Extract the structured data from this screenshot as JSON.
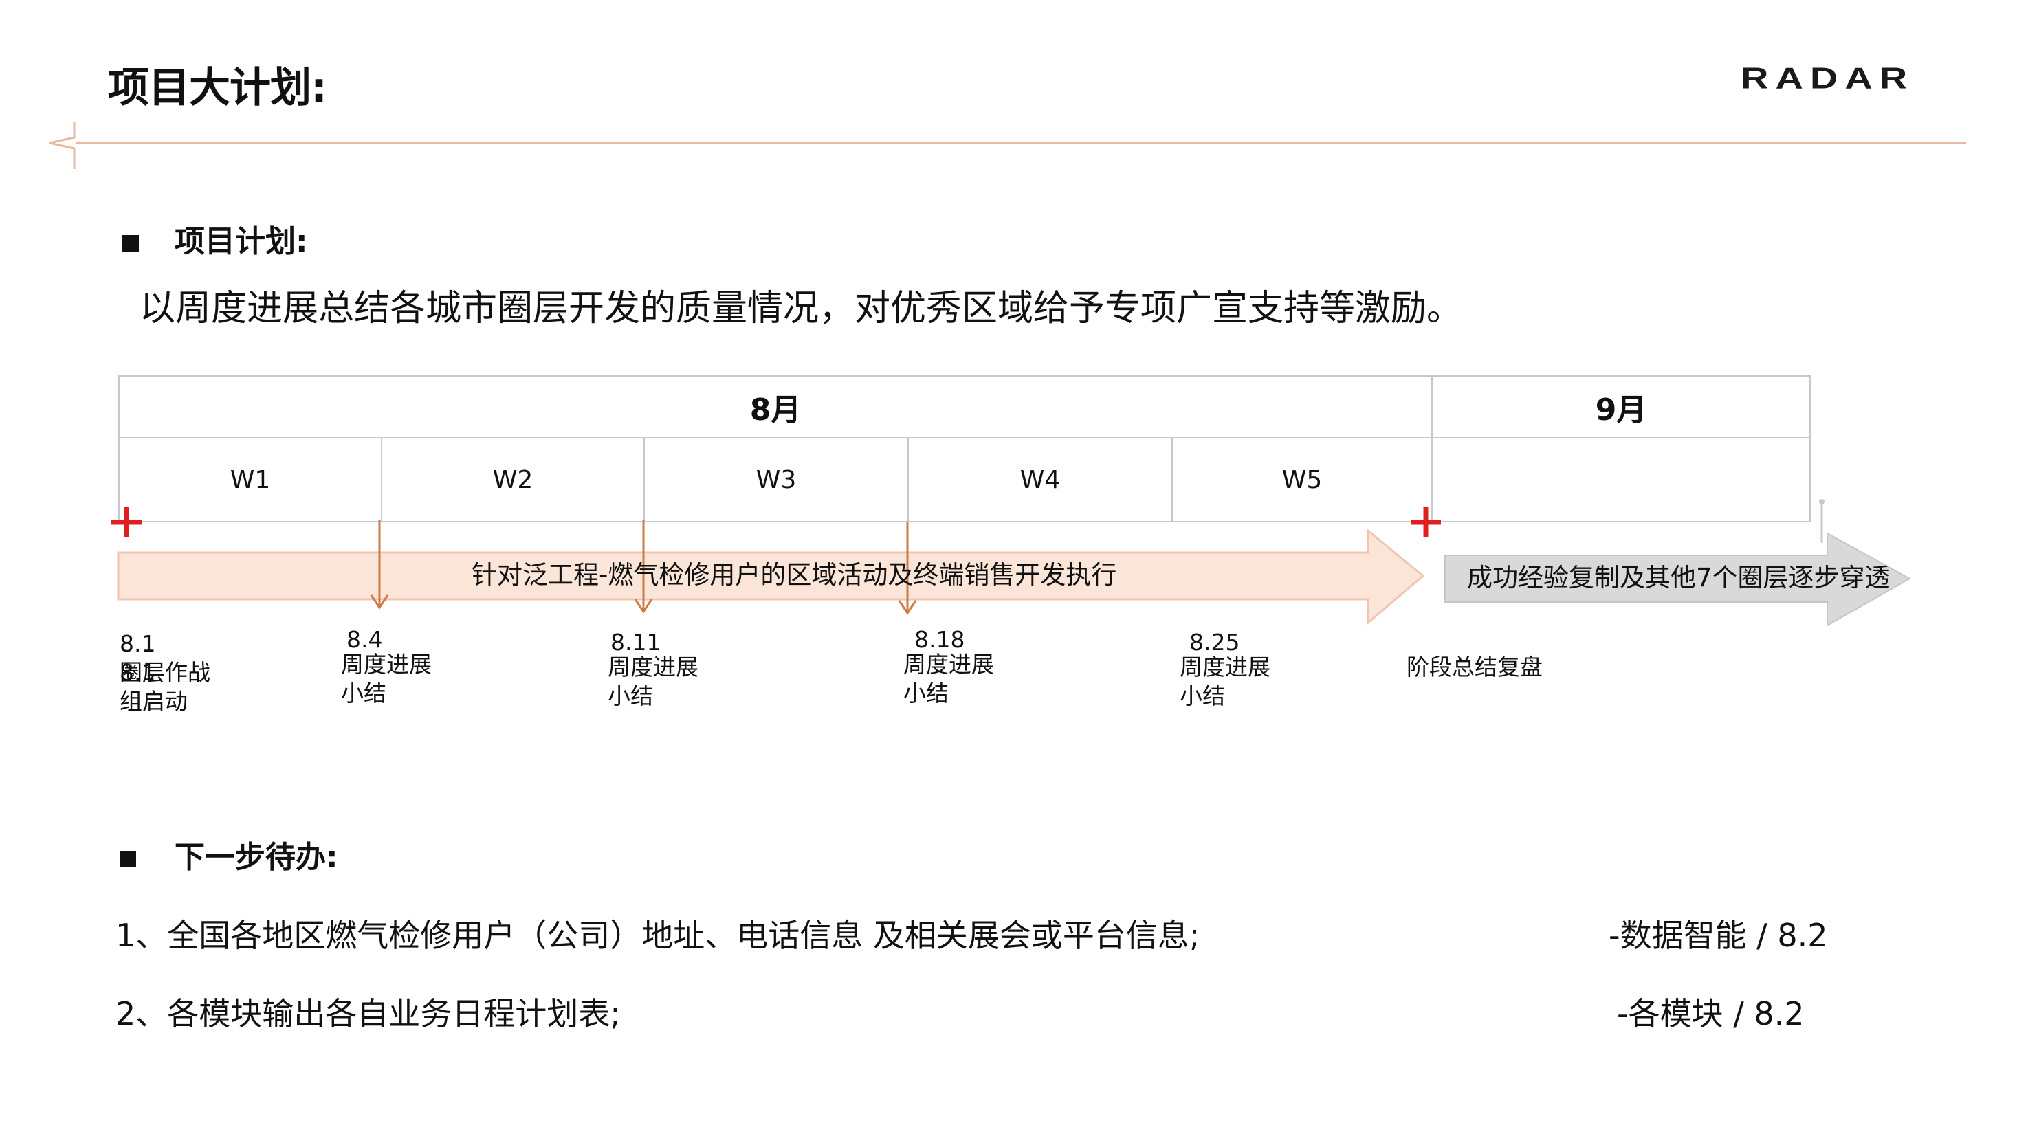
{
  "header": {
    "title": "项目大计划:",
    "logo_text": "RADAR",
    "accent_color": "#e8b9a1"
  },
  "plan": {
    "heading": "项目计划:",
    "description": "以周度进展总结各城市圈层开发的质量情况，对优秀区域给予专项广宣支持等激励。"
  },
  "timeline": {
    "months": [
      "8月",
      "9月"
    ],
    "weeks": [
      "W1",
      "W2",
      "W3",
      "W4",
      "W5"
    ],
    "phase1_label": "针对泛工程-燃气检修用户的区域活动及终端销售开发执行",
    "phase2_label": "成功经验复制及其他7个圈层逐步穿透",
    "phase1_color": "#fbe5d8",
    "phase2_color": "#d9d9d9",
    "marker_color": "#e02020",
    "milestones": [
      {
        "date": "8.1",
        "text": "圈层作战\n组启动",
        "overlap": "8.1"
      },
      {
        "date": "8.4",
        "text": "周度进展\n小结"
      },
      {
        "date": "8.11",
        "text": "周度进展\n小结"
      },
      {
        "date": "8.18",
        "text": "周度进展\n小结"
      },
      {
        "date": "8.25",
        "text": "周度进展\n小结"
      },
      {
        "date": "",
        "text": "阶段总结复盘"
      }
    ]
  },
  "next_steps": {
    "heading": "下一步待办:",
    "items": [
      {
        "text": "1、全国各地区燃气检修用户（公司）地址、电话信息 及相关展会或平台信息;",
        "owner": "-数据智能  /  8.2"
      },
      {
        "text": "2、各模块输出各自业务日程计划表;",
        "owner": "-各模块  /  8.2"
      }
    ]
  }
}
